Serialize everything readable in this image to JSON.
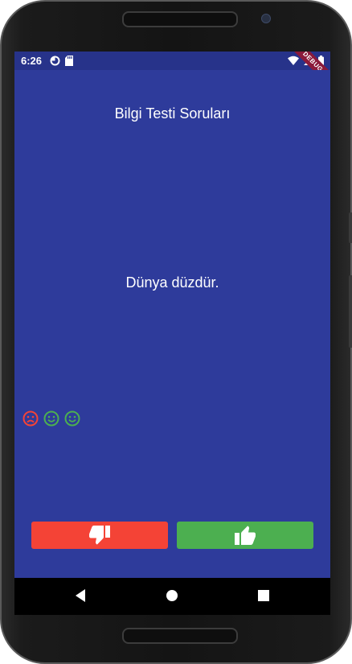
{
  "status_bar": {
    "time": "6:26",
    "left_icons": [
      "data-saver-icon",
      "sd-card-icon"
    ],
    "right_icons": [
      "wifi-icon",
      "signal-icon",
      "battery-icon"
    ]
  },
  "debug_banner": "DEBUG",
  "app": {
    "title": "Bilgi Testi Soruları",
    "question": "Dünya düzdür.",
    "score_icons": [
      {
        "icon": "sad-face-icon",
        "color": "#f44336"
      },
      {
        "icon": "happy-face-icon",
        "color": "#4caf50"
      },
      {
        "icon": "happy-face-icon",
        "color": "#4caf50"
      }
    ],
    "answer_buttons": {
      "false_icon": "thumbs-down-icon",
      "true_icon": "thumbs-up-icon",
      "false_color": "#f44336",
      "true_color": "#4caf50"
    },
    "background_color": "#2e3b9b"
  },
  "nav_bar": {
    "buttons": [
      "back-icon",
      "home-icon",
      "recents-icon"
    ]
  }
}
